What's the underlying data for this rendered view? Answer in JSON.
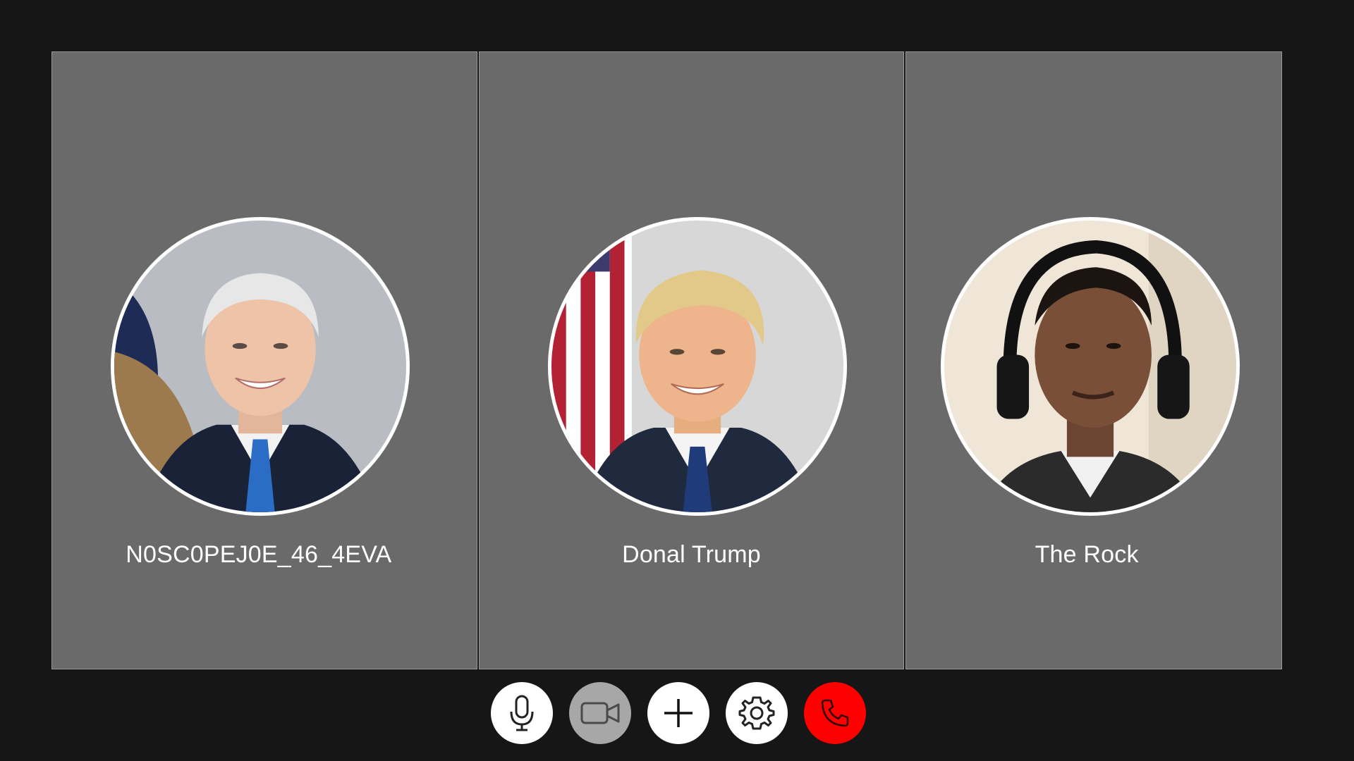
{
  "participants": [
    {
      "name": "N0SC0PEJ0E_46_4EVA",
      "avatar": "portrait-white-hair-blue-tie"
    },
    {
      "name": "Donal Trump",
      "avatar": "portrait-blond-hair-flag"
    },
    {
      "name": "The Rock",
      "avatar": "portrait-headphones"
    }
  ],
  "controls": [
    {
      "icon": "microphone-icon",
      "state": "on",
      "color": "#ffffff"
    },
    {
      "icon": "video-camera-icon",
      "state": "off",
      "color": "#a7a7a7"
    },
    {
      "icon": "add-icon",
      "color": "#ffffff"
    },
    {
      "icon": "gear-icon",
      "color": "#ffffff"
    },
    {
      "icon": "phone-hangup-icon",
      "color": "#ff0000"
    }
  ],
  "colors": {
    "background": "#161616",
    "tile": "#6a6a6a",
    "hangup": "#ff0000"
  }
}
